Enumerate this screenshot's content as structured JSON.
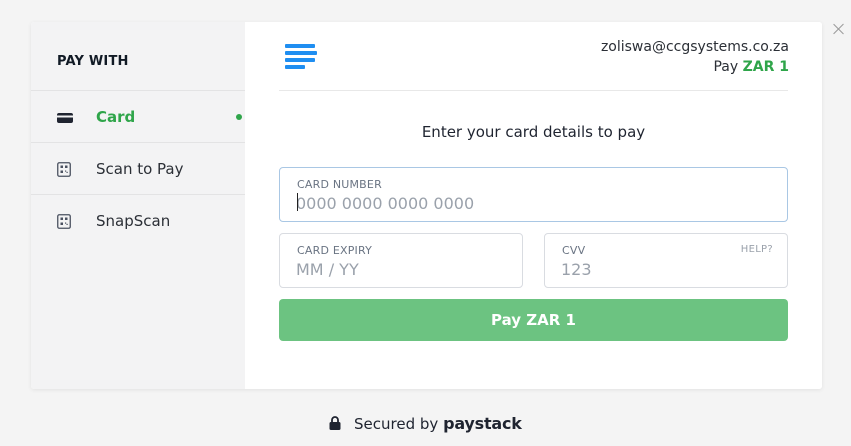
{
  "pay_with": {
    "title": "PAY WITH",
    "items": [
      {
        "label": "Card",
        "icon": "card-icon",
        "active": true
      },
      {
        "label": "Scan to Pay",
        "icon": "qr-icon",
        "active": false
      },
      {
        "label": "SnapScan",
        "icon": "qr-icon",
        "active": false
      }
    ]
  },
  "merchant": {
    "email": "zoliswa@ccgsystems.co.za",
    "pay_prefix": "Pay",
    "amount": "ZAR 1"
  },
  "form": {
    "instruction": "Enter your card details to pay",
    "card_number_label": "CARD NUMBER",
    "card_number_placeholder": "0000 0000 0000 0000",
    "card_expiry_label": "CARD EXPIRY",
    "card_expiry_placeholder": "MM / YY",
    "cvv_label": "CVV",
    "cvv_help": "HELP?",
    "cvv_placeholder": "123",
    "pay_button_label": "Pay ZAR 1"
  },
  "footer": {
    "secured_by": "Secured by",
    "brand": "paystack"
  },
  "colors": {
    "accent_green": "#2fa54a",
    "button_green": "#6cc381",
    "logo_blue": "#1f8ef1"
  }
}
